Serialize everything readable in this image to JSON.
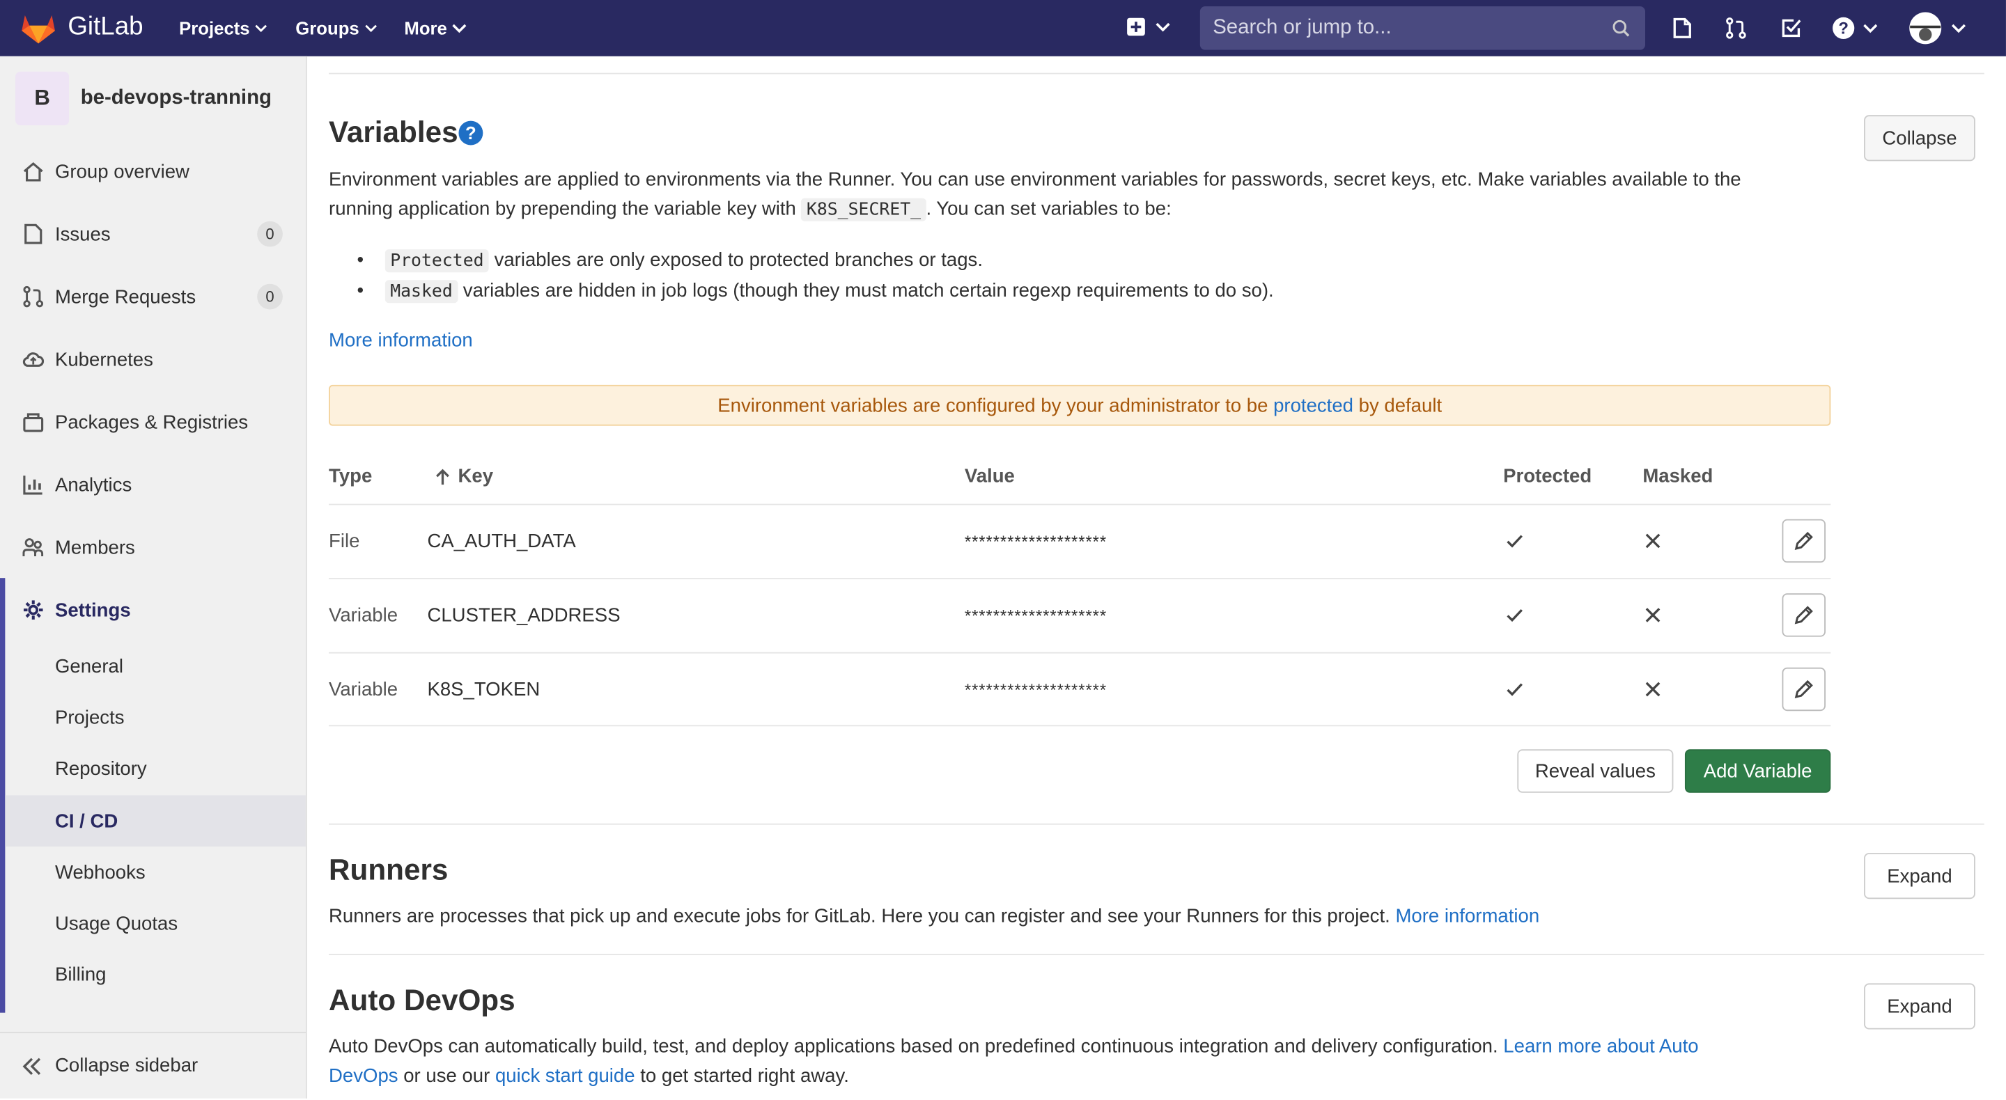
{
  "topbar": {
    "brand": "GitLab",
    "nav": [
      "Projects",
      "Groups",
      "More"
    ],
    "search_placeholder": "Search or jump to..."
  },
  "sidebar": {
    "group_initial": "B",
    "group_name": "be-devops-tranning",
    "items": [
      {
        "label": "Group overview",
        "icon": "home-icon"
      },
      {
        "label": "Issues",
        "icon": "issues-icon",
        "badge": "0"
      },
      {
        "label": "Merge Requests",
        "icon": "merge-request-icon",
        "badge": "0"
      },
      {
        "label": "Kubernetes",
        "icon": "cloud-icon"
      },
      {
        "label": "Packages & Registries",
        "icon": "package-icon"
      },
      {
        "label": "Analytics",
        "icon": "chart-icon"
      },
      {
        "label": "Members",
        "icon": "users-icon"
      },
      {
        "label": "Settings",
        "icon": "gear-icon"
      }
    ],
    "settings_sub": [
      "General",
      "Projects",
      "Repository",
      "CI / CD",
      "Webhooks",
      "Usage Quotas",
      "Billing"
    ],
    "collapse_label": "Collapse sidebar"
  },
  "variables": {
    "title": "Variables",
    "collapse_label": "Collapse",
    "desc_1": "Environment variables are applied to environments via the Runner. You can use environment variables for passwords, secret keys, etc. Make variables available to the",
    "desc_2a": "running application by prepending the variable key with",
    "desc_code": "K8S_SECRET_",
    "desc_2b": ". You can set variables to be:",
    "bullet_1_code": "Protected",
    "bullet_1_text": "variables are only exposed to protected branches or tags.",
    "bullet_2_code": "Masked",
    "bullet_2_text": "variables are hidden in job logs (though they must match certain regexp requirements to do so).",
    "more_info": "More information",
    "alert_a": "Environment variables are configured by your administrator to be",
    "alert_link": "protected",
    "alert_b": "by default",
    "headers": {
      "type": "Type",
      "key": "Key",
      "value": "Value",
      "protected": "Protected",
      "masked": "Masked"
    },
    "rows": [
      {
        "type": "File",
        "key": "CA_AUTH_DATA",
        "value": "********************"
      },
      {
        "type": "Variable",
        "key": "CLUSTER_ADDRESS",
        "value": "********************"
      },
      {
        "type": "Variable",
        "key": "K8S_TOKEN",
        "value": "********************"
      }
    ],
    "reveal_label": "Reveal values",
    "add_label": "Add Variable"
  },
  "runners": {
    "title": "Runners",
    "expand_label": "Expand",
    "desc": "Runners are processes that pick up and execute jobs for GitLab. Here you can register and see your Runners for this project.",
    "link": "More information"
  },
  "autodevops": {
    "title": "Auto DevOps",
    "expand_label": "Expand",
    "desc_a": "Auto DevOps can automatically build, test, and deploy applications based on predefined continuous integration and delivery configuration.",
    "link_1a": "Learn more about Auto",
    "link_1b": "DevOps",
    "desc_b": "or use our",
    "link_2": "quick start guide",
    "desc_c": "to get started right away."
  }
}
